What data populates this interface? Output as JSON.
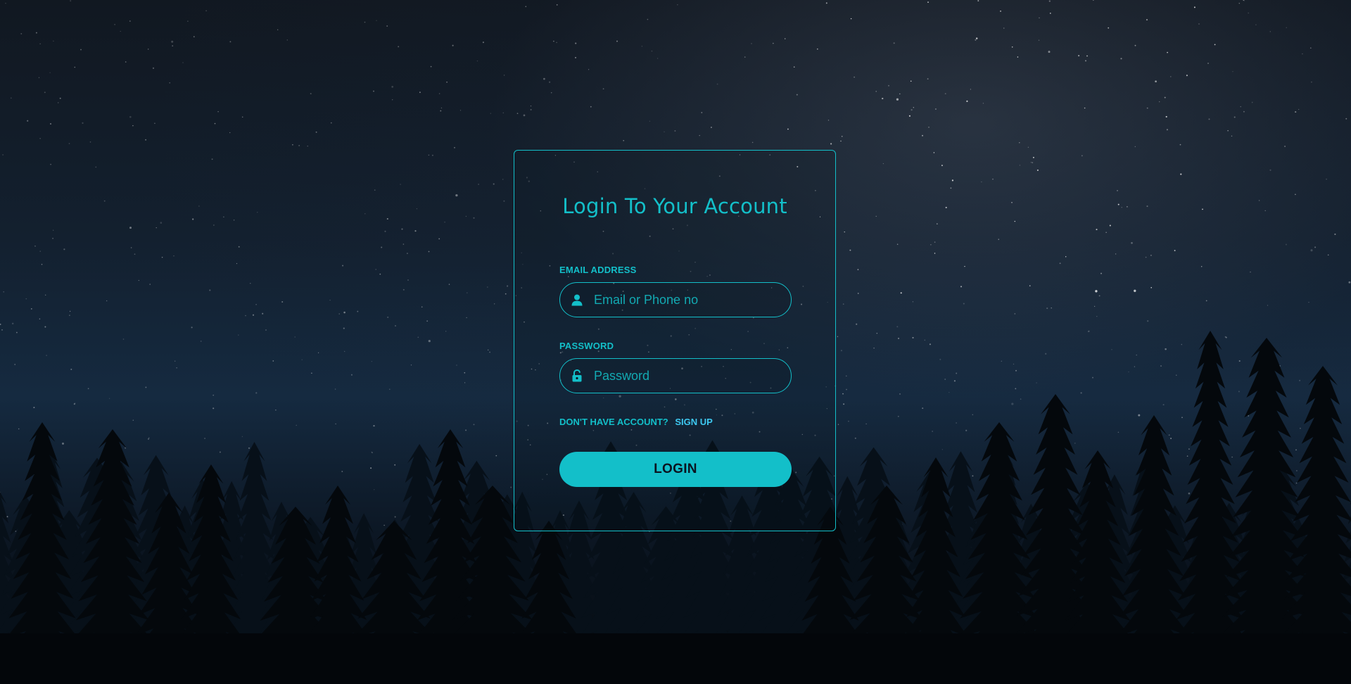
{
  "page": {
    "title": "Login To Your Account"
  },
  "form": {
    "email": {
      "label": "EMAIL ADDRESS",
      "placeholder": "Email or Phone no",
      "value": "",
      "icon": "user-icon"
    },
    "password": {
      "label": "PASSWORD",
      "placeholder": "Password",
      "value": "",
      "icon": "unlock-icon"
    },
    "signup_prompt": "DON'T HAVE ACCOUNT?",
    "signup_link": "SIGN UP",
    "login_button": "LOGIN"
  },
  "colors": {
    "accent": "#13bfc9",
    "link": "#3ec8f0",
    "background": "#0b1420"
  }
}
